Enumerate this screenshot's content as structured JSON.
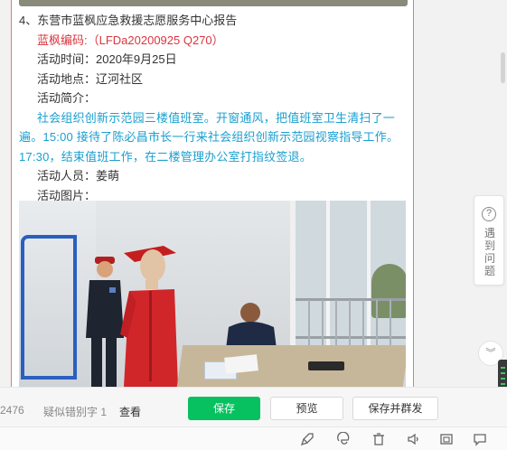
{
  "article": {
    "heading": "4、东营市蓝枫应急救援志愿服务中心报告",
    "code_line": "蓝枫编码:（LFDa20200925  Q270）",
    "time_line": "活动时间：2020年9月25日",
    "place_line": "活动地点：辽河社区",
    "intro_label": "活动简介：",
    "intro_text": "社会组织创新示范园三楼值班室。开窗通风，把值班室卫生清扫了一遍。15:00 接待了陈必昌市长一行来社会组织创新示范园视察指导工作。17:30，结束值班工作，在二楼管理办公室打指纹签退。",
    "people_line": "活动人员：姜萌",
    "photo_label": "活动图片："
  },
  "float": {
    "help_icon": "question-circle-icon",
    "help_text": "遇到问题",
    "collapse_icon": "double-chevron-down-icon"
  },
  "toolbar": {
    "word_count": "2476",
    "typo_label": "疑似错别字 1",
    "check_label": "查看",
    "save_label": "保存",
    "preview_label": "预览",
    "save_send_label": "保存并群发"
  },
  "taskbar": {
    "icons": [
      "rocket-icon",
      "edge-icon",
      "trash-icon",
      "speaker-icon",
      "window-icon",
      "chat-icon"
    ]
  },
  "colors": {
    "accent_green": "#07c160",
    "code_red": "#d9363e",
    "intro_blue": "#1a9fd0",
    "doc_border": "#e07b7b"
  }
}
